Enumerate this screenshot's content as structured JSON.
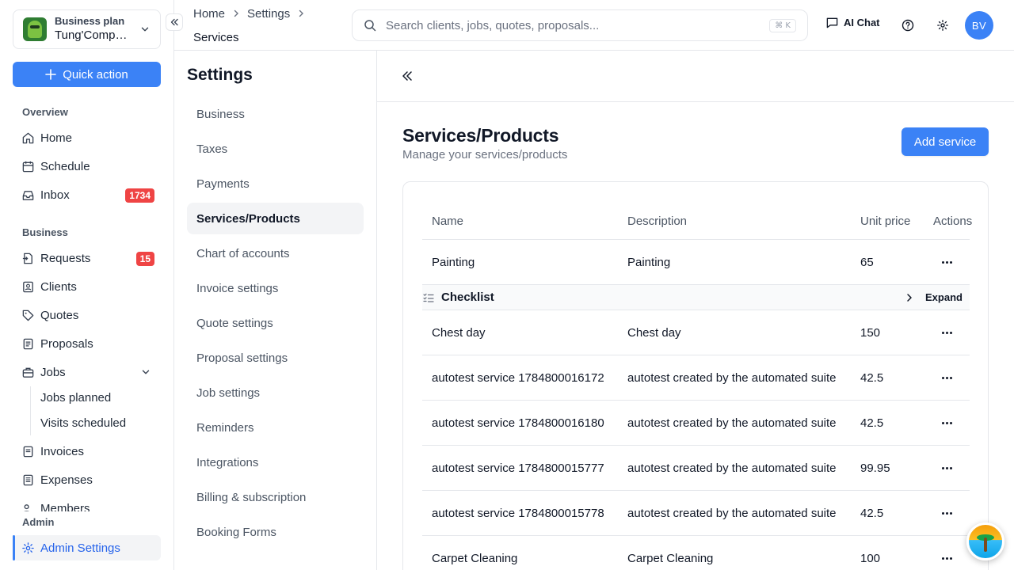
{
  "colors": {
    "accent": "#3b82f6",
    "badge": "#ef4444",
    "active_nav_text": "#2563eb"
  },
  "org": {
    "plan": "Business plan",
    "name": "Tung'Company"
  },
  "sidebar": {
    "quick_action": "Quick action",
    "overview_label": "Overview",
    "business_label": "Business",
    "admin_label": "Admin",
    "items": {
      "home": {
        "label": "Home",
        "icon": "home-icon"
      },
      "schedule": {
        "label": "Schedule",
        "icon": "calendar-icon"
      },
      "inbox": {
        "label": "Inbox",
        "icon": "inbox-icon",
        "badge": "1734"
      },
      "requests": {
        "label": "Requests",
        "icon": "request-icon",
        "badge": "15"
      },
      "clients": {
        "label": "Clients",
        "icon": "contact-icon"
      },
      "quotes": {
        "label": "Quotes",
        "icon": "tag-icon"
      },
      "proposals": {
        "label": "Proposals",
        "icon": "document-icon"
      },
      "jobs": {
        "label": "Jobs",
        "icon": "briefcase-icon"
      },
      "jobs_planned": {
        "label": "Jobs planned"
      },
      "visits_scheduled": {
        "label": "Visits scheduled"
      },
      "invoices": {
        "label": "Invoices",
        "icon": "invoice-icon"
      },
      "expenses": {
        "label": "Expenses",
        "icon": "receipt-icon"
      },
      "members": {
        "label": "Members",
        "icon": "users-icon"
      },
      "admin_settings": {
        "label": "Admin Settings",
        "icon": "gear-icon"
      }
    }
  },
  "topbar": {
    "breadcrumbs": [
      "Home",
      "Settings"
    ],
    "current": "Services",
    "search_placeholder": "Search clients, jobs, quotes, proposals...",
    "search_shortcut": "⌘ K",
    "ai_chat": "AI Chat",
    "avatar_initials": "BV"
  },
  "settings_nav": {
    "title": "Settings",
    "items": [
      "Business",
      "Taxes",
      "Payments",
      "Services/Products",
      "Chart of accounts",
      "Invoice settings",
      "Quote settings",
      "Proposal settings",
      "Job settings",
      "Reminders",
      "Integrations",
      "Billing & subscription",
      "Booking Forms"
    ],
    "active_index": 3
  },
  "main": {
    "title": "Services/Products",
    "subtitle": "Manage your services/products",
    "add_button": "Add service",
    "columns": [
      "Name",
      "Description",
      "Unit price",
      "Actions"
    ],
    "checklist": {
      "label": "Checklist",
      "expand": "Expand"
    },
    "rows": [
      {
        "name": "Painting",
        "description": "Painting",
        "price": "65"
      },
      {
        "name": "Chest day",
        "description": "Chest day",
        "price": "150"
      },
      {
        "name": "autotest service 1784800016172",
        "description": "autotest created by the automated suite",
        "price": "42.5"
      },
      {
        "name": "autotest service 1784800016180",
        "description": "autotest created by the automated suite",
        "price": "42.5"
      },
      {
        "name": "autotest service 1784800015777",
        "description": "autotest created by the automated suite",
        "price": "99.95"
      },
      {
        "name": "autotest service 1784800015778",
        "description": "autotest created by the automated suite",
        "price": "42.5"
      },
      {
        "name": "Carpet Cleaning",
        "description": "Carpet Cleaning",
        "price": "100"
      }
    ]
  }
}
